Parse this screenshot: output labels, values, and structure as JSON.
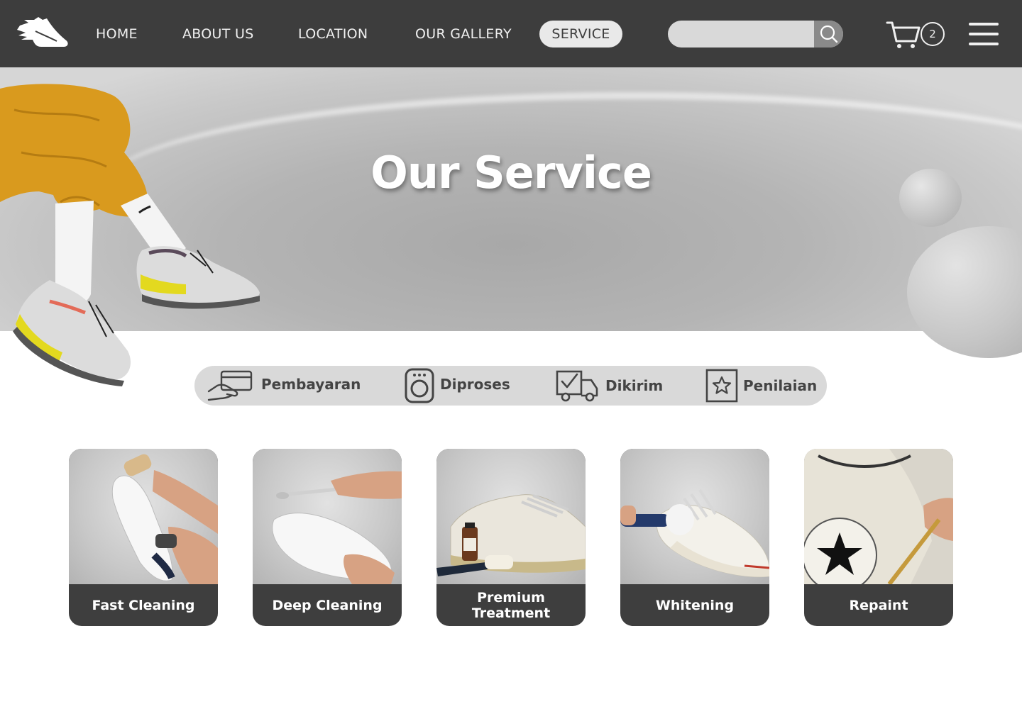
{
  "nav": {
    "items": [
      "HOME",
      "ABOUT US",
      "LOCATION",
      "OUR GALLERY"
    ],
    "active": "SERVICE"
  },
  "search": {
    "placeholder": ""
  },
  "cart": {
    "count": "2"
  },
  "hero": {
    "title": "Our Service"
  },
  "steps": [
    {
      "label": "Pembayaran",
      "icon": "card-payment-icon"
    },
    {
      "label": "Diproses",
      "icon": "washing-machine-icon"
    },
    {
      "label": "Dikirim",
      "icon": "delivery-truck-icon"
    },
    {
      "label": "Penilaian",
      "icon": "star-rating-icon"
    }
  ],
  "services": [
    {
      "label": "Fast Cleaning"
    },
    {
      "label": "Deep Cleaning"
    },
    {
      "label": "Premium Treatment"
    },
    {
      "label": "Whitening"
    },
    {
      "label": "Repaint"
    }
  ],
  "colors": {
    "header": "#3d3d3d",
    "card_footer": "#3e3e3e",
    "steps_bar": "#d9d9d9",
    "pants": "#d99a1e",
    "sole_accent": "#e3d91f"
  }
}
